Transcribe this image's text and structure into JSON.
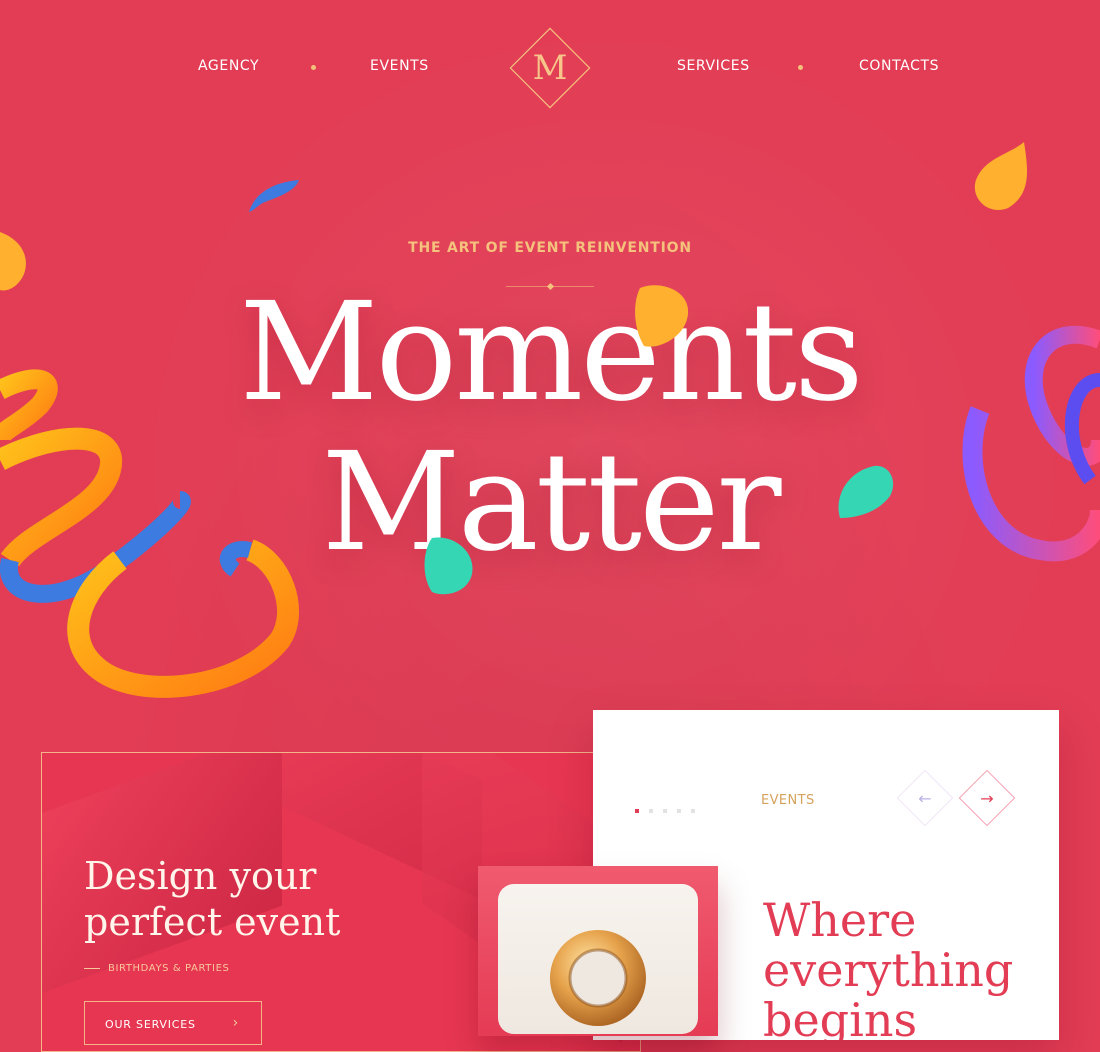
{
  "nav": {
    "items": [
      "AGENCY",
      "EVENTS",
      "SERVICES",
      "CONTACTS"
    ],
    "logo_letter": "M"
  },
  "hero": {
    "kicker": "THE ART OF EVENT REINVENTION",
    "title_line1": "Moments",
    "title_line2": "Matter"
  },
  "card_left": {
    "title": "Design your perfect event",
    "subtitle": "BIRTHDAYS & PARTIES",
    "button_label": "OUR SERVICES",
    "button_icon": "arrow-right-icon"
  },
  "card_right": {
    "label": "EVENTS",
    "title": "Where everything begins",
    "pager_count": 5,
    "pager_active": 0,
    "prev_icon": "arrow-left-icon",
    "next_icon": "arrow-right-icon"
  },
  "colors": {
    "background": "#e23d55",
    "accent_gold": "#f4c27c",
    "card_white": "#ffffff",
    "title_red": "#e23d55"
  }
}
